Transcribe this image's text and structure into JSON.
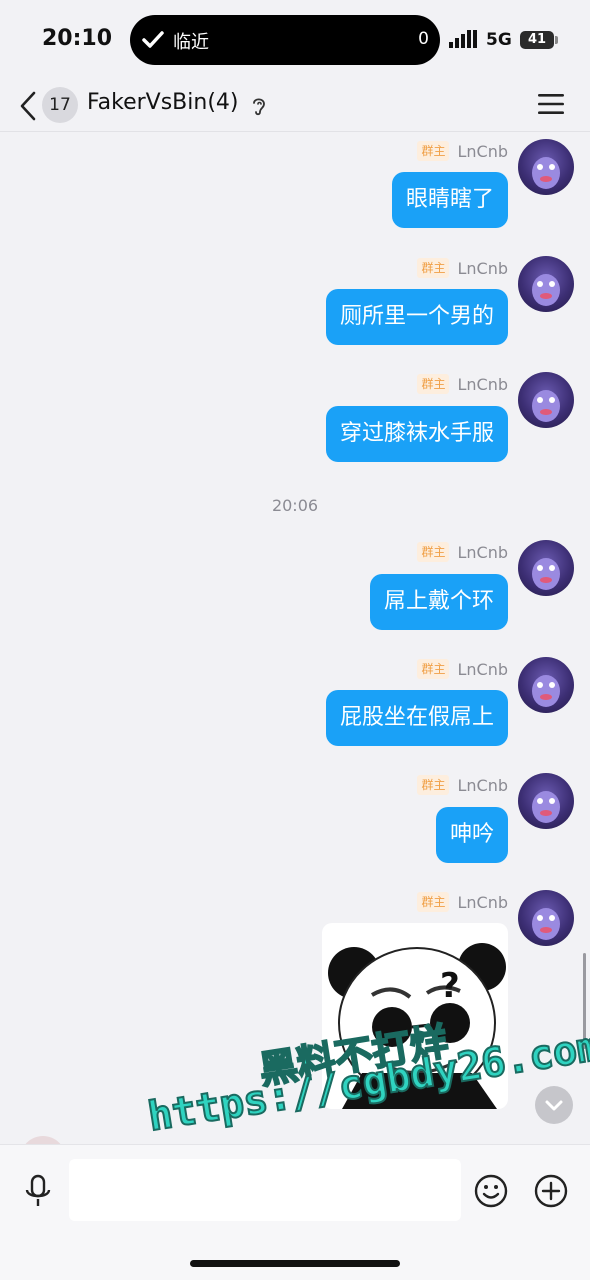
{
  "status_bar": {
    "time": "20:10",
    "island_label": "临近",
    "island_count": "0",
    "network": "5G",
    "battery": "41"
  },
  "header": {
    "unread_count": "17",
    "title": "FakerVsBin(4)",
    "back_icon": "chevron-left-icon",
    "ear_icon": "ear-icon",
    "menu_icon": "hamburger-menu-icon"
  },
  "messages": [
    {
      "role": "群主",
      "sender": "LnCnb",
      "text": "眼睛瞎了"
    },
    {
      "role": "群主",
      "sender": "LnCnb",
      "text": "厕所里一个男的"
    },
    {
      "role": "群主",
      "sender": "LnCnb",
      "text": "穿过膝袜水手服"
    },
    {
      "role": "群主",
      "sender": "LnCnb",
      "text": "屌上戴个环"
    },
    {
      "role": "群主",
      "sender": "LnCnb",
      "text": "屁股坐在假屌上"
    },
    {
      "role": "群主",
      "sender": "LnCnb",
      "text": "呻吟"
    },
    {
      "role": "群主",
      "sender": "LnCnb",
      "sticker": "panda-meme-sticker"
    }
  ],
  "timestamp": "20:06",
  "watermark": {
    "line1": "黑料不打烊",
    "line2": "https://cgbdy26.com"
  },
  "input_bar": {
    "value": "",
    "mic_icon": "microphone-icon",
    "emoji_icon": "emoji-icon",
    "plus_icon": "plus-circle-icon"
  },
  "colors": {
    "bubble": "#1aa1f7",
    "background": "#f2f2f5",
    "role_badge_text": "#f0a047",
    "watermark": "#2fd3c0"
  }
}
